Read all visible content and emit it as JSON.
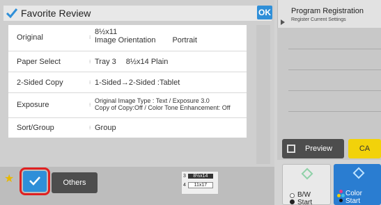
{
  "header": {
    "title": "Favorite Review",
    "ok_label": "OK"
  },
  "settings": [
    {
      "label": "Original",
      "lines": [
        "8½x11",
        "Image Orientation\tPortrait"
      ]
    },
    {
      "label": "Paper Select",
      "lines": [
        "Tray 3\t8½x14  Plain"
      ]
    },
    {
      "label": "2-Sided Copy",
      "lines": [
        "1-Sided→2-Sided  :Tablet"
      ]
    },
    {
      "label": "Exposure",
      "lines": [
        "Original Image Type : Text / Exposure 3.0",
        "Copy of Copy:Off / Color Tone Enhancement: Off"
      ]
    },
    {
      "label": "Sort/Group",
      "lines": [
        "Group"
      ]
    }
  ],
  "program": {
    "title": "Program Registration",
    "subtitle": "Register Current Settings"
  },
  "actions": {
    "preview_label": "Preview",
    "ca_label": "CA",
    "bw_start_line1": "B/W",
    "bw_start_line2": "Start",
    "color_start_line1": "Color",
    "color_start_line2": "Start"
  },
  "bottom": {
    "others_label": "Others",
    "tray_rows": [
      {
        "num": "3",
        "paper": "8½x14",
        "selected": true
      },
      {
        "num": "4",
        "paper": "11x17",
        "selected": false
      }
    ]
  },
  "colors": {
    "accent_blue": "#2f8fd8",
    "ca_yellow": "#f2d20a",
    "highlight_red": "#e02020"
  }
}
